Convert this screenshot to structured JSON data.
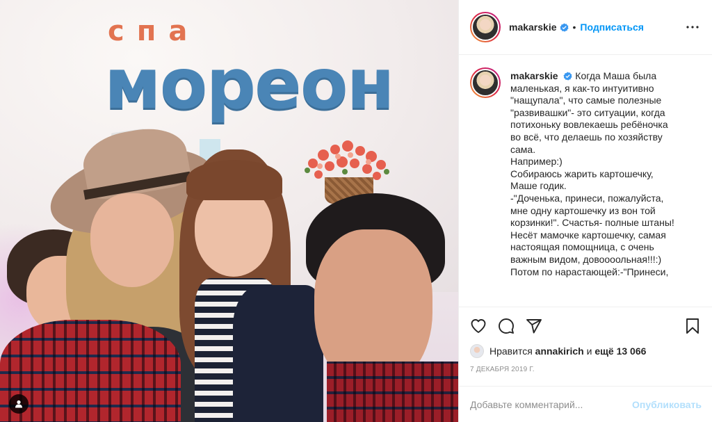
{
  "photo": {
    "sign_small": "спа",
    "sign_big": "мореон"
  },
  "header": {
    "username": "makarskie",
    "dot": "•",
    "follow_label": "Подписаться"
  },
  "caption": {
    "username": "makarskie",
    "lines": [
      "Когда Маша была",
      "маленькая, я как-то интуитивно",
      "\"нащупала\", что самые полезные",
      "\"развивашки\"- это ситуации, когда",
      "потихоньку вовлекаешь ребёночка",
      "во всё, что делаешь по хозяйству",
      "сама.",
      "Например:)",
      "Собираюсь жарить картошечку,",
      "Маше годик.",
      "-\"Доченька, принеси, пожалуйста,",
      "мне одну картошечку из вон той",
      "корзинки!\". Счастья- полные штаны!",
      "Несёт мамочке картошечку, самая",
      "настоящая помощница, с очень",
      "важным видом, довоооольная!!!:)",
      "Потом по нарастающей:-\"Принеси,"
    ]
  },
  "likes": {
    "prefix": "Нравится",
    "user": "annakirich",
    "middle": "и",
    "others": "ещё 13 066"
  },
  "date": "7 ДЕКАБРЯ 2019 Г.",
  "comment": {
    "placeholder": "Добавьте комментарий...",
    "publish_label": "Опубликовать"
  },
  "colors": {
    "accent": "#0095f6",
    "publish_disabled": "#b2dffc",
    "muted": "#8e8e8e"
  },
  "icons": [
    "user-tag-icon",
    "verified-badge-icon",
    "more-options-icon",
    "heart-icon",
    "comment-icon",
    "share-icon",
    "bookmark-icon"
  ]
}
